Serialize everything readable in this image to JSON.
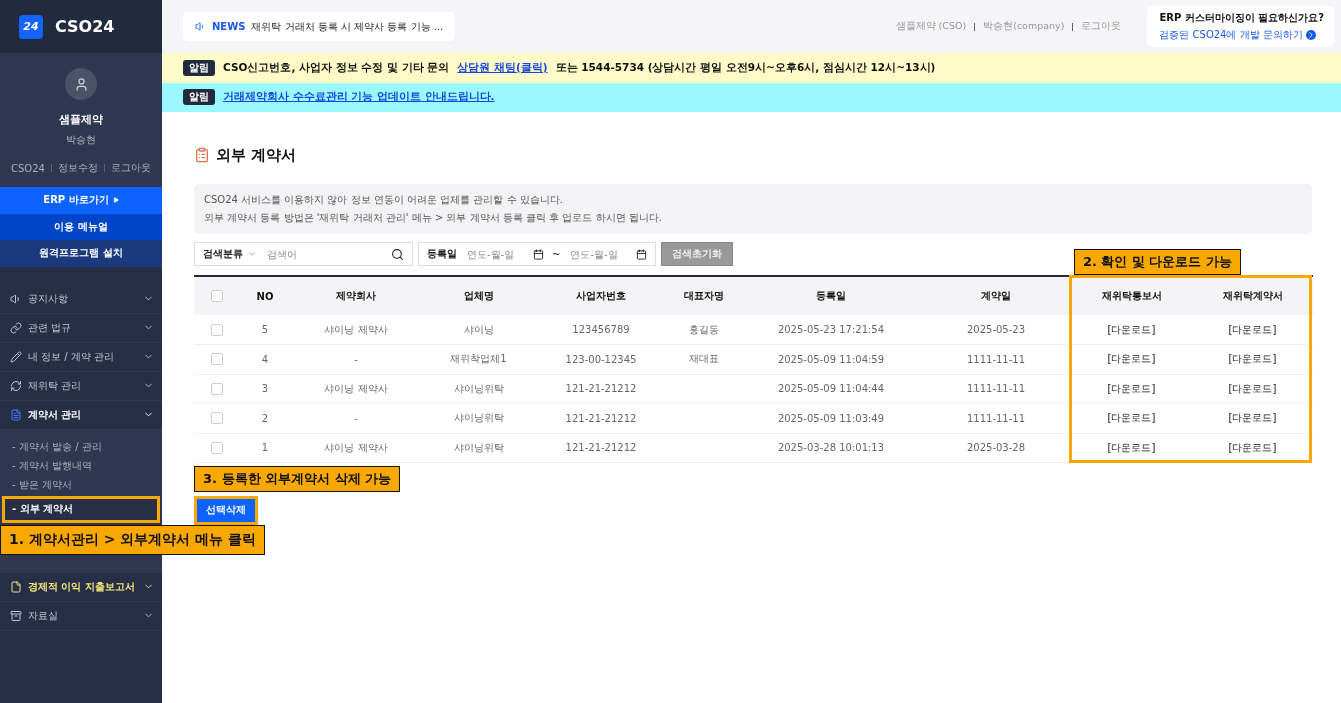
{
  "brand": {
    "badge": "24",
    "name": "CSO24"
  },
  "profile": {
    "company": "샘플제약",
    "user": "박승현",
    "links": [
      "CSO24",
      "정보수정",
      "로그아웃"
    ]
  },
  "quick_buttons": [
    {
      "label": "ERP 바로가기",
      "kind": "primary",
      "arrow": true
    },
    {
      "label": "이용 메뉴얼",
      "kind": "secondary",
      "arrow": false
    },
    {
      "label": "원격프로그램 설치",
      "kind": "tertiary",
      "arrow": false
    }
  ],
  "menu": [
    {
      "label": "공지사항",
      "expanded": false,
      "highlighted": false
    },
    {
      "label": "관련 법규",
      "expanded": false,
      "highlighted": false
    },
    {
      "label": "내 정보 / 계약 관리",
      "expanded": false,
      "highlighted": false
    },
    {
      "label": "재위탁 관리",
      "expanded": false,
      "highlighted": false
    },
    {
      "label": "계약서 관리",
      "expanded": true,
      "highlighted": false,
      "children": [
        {
          "label": "- 계약서 발송 / 관리",
          "selected": false
        },
        {
          "label": "- 계약서 발행내역",
          "selected": false
        },
        {
          "label": "- 받은 계약서",
          "selected": false
        },
        {
          "label": "- 외부 계약서",
          "selected": true
        }
      ]
    },
    {
      "label": "경제적 이익 지출보고서",
      "expanded": false,
      "highlighted": true
    },
    {
      "label": "자료실",
      "expanded": false,
      "highlighted": false
    }
  ],
  "news": {
    "label": "NEWS",
    "text": "재위탁 거래처 등록 시 제약사 등록 기능 ..."
  },
  "top_links": [
    "샘플제약 (CSO)",
    "박승현(company)",
    "로그아웃"
  ],
  "promo": {
    "title": "ERP 커스터마이징이 필요하신가요?",
    "link": "검증된 CSO24에 개발 문의하기"
  },
  "notices": [
    {
      "tag": "알림",
      "color": "#fffbc8",
      "before": "CSO신고번호, 사업자 정보 수정 및 기타 문의 ",
      "link": "상담원 채팅(클릭)",
      "after": " 또는 1544-5734 (상담시간 평일 오전9시~오후6시, 점심시간 12시~13시)"
    },
    {
      "tag": "알림",
      "color": "#9cf8ff",
      "link": "거래제약회사 수수료관리 기능 업데이트 안내드립니다."
    }
  ],
  "page_title": "외부 계약서",
  "info": [
    "CSO24 서비스를 이용하지 않아 정보 연동이 어려운 업체를 관리할 수 있습니다.",
    "외부 계약서 등록 방법은 '재위탁 거래처 관리' 메뉴 > 외부 계약서 등록 클릭 후 업로드 하시면 됩니다."
  ],
  "search": {
    "category": "검색분류",
    "placeholder": "검색어",
    "date_label": "등록일",
    "date_from": {
      "placeholder": "연도-월-일"
    },
    "date_sep": "~",
    "date_to": {
      "placeholder": "연도-월-일"
    },
    "reset": "검색초기화"
  },
  "table": {
    "all_checked": false,
    "columns": [
      "NO",
      "제약회사",
      "업체명",
      "사업자번호",
      "대표자명",
      "등록일",
      "계약일",
      "재위탁통보서",
      "재위탁계약서"
    ],
    "rows": [
      {
        "checked": false,
        "cells": [
          "5",
          "샤이닝 제약사",
          "샤이닝",
          "123456789",
          "홍길동",
          "2025-05-23 17:21:54",
          "2025-05-23",
          "[다운로드]",
          "[다운로드]"
        ]
      },
      {
        "checked": false,
        "cells": [
          "4",
          "-",
          "재위착업체1",
          "123-00-12345",
          "재대표",
          "2025-05-09 11:04:59",
          "1111-11-11",
          "[다운로드]",
          "[다운로드]"
        ]
      },
      {
        "checked": false,
        "cells": [
          "3",
          "샤이닝 제약사",
          "샤이닝위탁",
          "121-21-21212",
          "",
          "2025-05-09 11:04:44",
          "1111-11-11",
          "[다운로드]",
          "[다운로드]"
        ]
      },
      {
        "checked": false,
        "cells": [
          "2",
          "-",
          "샤이닝위탁",
          "121-21-21212",
          "",
          "2025-05-09 11:03:49",
          "1111-11-11",
          "[다운로드]",
          "[다운로드]"
        ]
      },
      {
        "checked": false,
        "cells": [
          "1",
          "샤이닝 제약사",
          "샤이닝위탁",
          "121-21-21212",
          "",
          "2025-03-28 10:01:13",
          "2025-03-28",
          "[다운로드]",
          "[다운로드]"
        ]
      }
    ]
  },
  "delete_button": "선택삭제",
  "annotations": [
    "1. 계약서관리 > 외부계약서 메뉴 클릭",
    "2. 확인 및 다운로드 가능",
    "3. 등록한 외부계약서 삭제 가능"
  ]
}
